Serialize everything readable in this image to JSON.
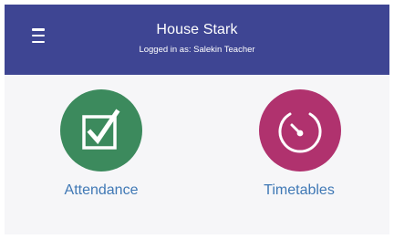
{
  "header": {
    "title": "House Stark",
    "subtitle": "Logged in as: Salekin Teacher",
    "color": "#3e4593"
  },
  "tiles": [
    {
      "label": "Attendance",
      "icon": "checkbox-check-icon",
      "color": "#3c8a5d"
    },
    {
      "label": "Timetables",
      "icon": "clock-icon",
      "color": "#b0326e"
    }
  ],
  "label_color": "#3f78b5"
}
